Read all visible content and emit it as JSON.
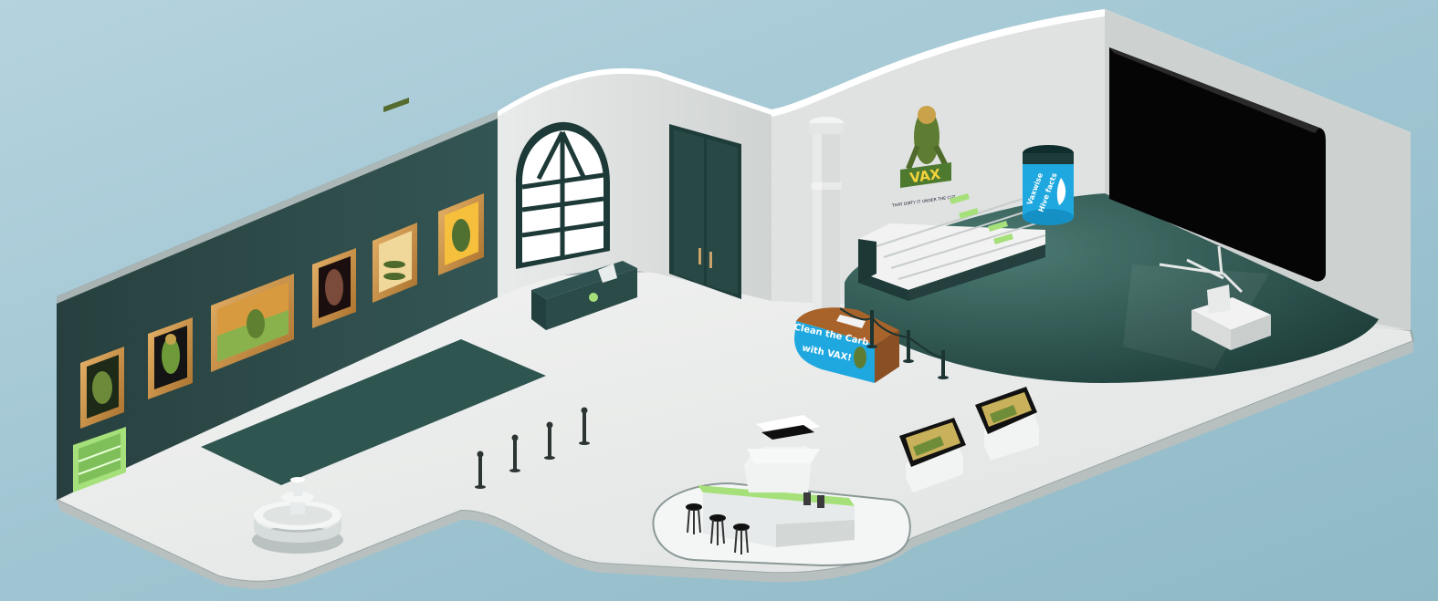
{
  "scene": {
    "description_colors": {
      "background": "#a9cbd7",
      "wall_dark": "#2d4a4d",
      "wall_light": "#e6e8e7",
      "floor": "#e9ebea",
      "accent_green": "#a6e07a",
      "accent_blue": "#1fa8e0",
      "screen": "#050505"
    }
  },
  "signage": {
    "vax_sign": "VAX",
    "vax_tagline": "THAT DIRTY IT UNDER THE CUT",
    "kiosk_line1": "Clean the Carb",
    "kiosk_line2": "with VAX!",
    "tower_line1": "Vaxwise",
    "tower_line2": "Hive facts"
  },
  "icons": {
    "fountain": "fountain-icon",
    "stool": "bar-stool-icon",
    "stanchion": "stanchion-post-icon",
    "bookshelf": "bookshelf-icon",
    "drone": "drone-icon"
  }
}
